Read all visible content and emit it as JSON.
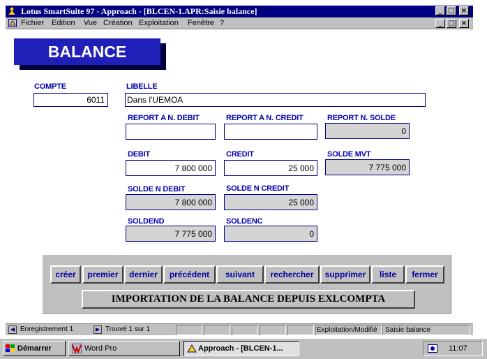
{
  "window": {
    "title_app": "Lotus SmartSuite 97",
    "title_rest": "  -  Approach - [BLCEN-1.APR:Saisie balance]",
    "controls": {
      "minimize": "_",
      "maximize": "□",
      "close": "×"
    }
  },
  "menu": {
    "items": [
      {
        "label": "Fichier"
      },
      {
        "label": "Edition"
      },
      {
        "label": "Vue"
      },
      {
        "label": "Création"
      },
      {
        "label": "Exploitation"
      },
      {
        "label": "Fenêtre"
      },
      {
        "label": "?"
      }
    ]
  },
  "form": {
    "banner": "BALANCE",
    "compte": {
      "label": "COMPTE",
      "value": "6011"
    },
    "libelle": {
      "label": "LIBELLE",
      "value": "Dans l'UEMOA"
    },
    "report_debit": {
      "label": "REPORT A N. DEBIT",
      "value": ""
    },
    "report_credit": {
      "label": "REPORT A N. CREDIT",
      "value": ""
    },
    "report_solde": {
      "label": "REPORT N. SOLDE",
      "value": "0"
    },
    "debit": {
      "label": "DEBIT",
      "value": "7 800 000"
    },
    "credit": {
      "label": "CREDIT",
      "value": "25 000"
    },
    "solde_mvt": {
      "label": "SOLDE MVT",
      "value": "7 775 000"
    },
    "solde_n_debit": {
      "label": "SOLDE N DEBIT",
      "value": "7 800 000"
    },
    "solde_n_credit": {
      "label": "SOLDE N CREDIT",
      "value": "25 000"
    },
    "soldend": {
      "label": "SOLDEND",
      "value": "7 775 000"
    },
    "soldenc": {
      "label": "SOLDENC",
      "value": "0"
    }
  },
  "buttons": {
    "creer": "créer",
    "premier": "premier",
    "dernier": "dernier",
    "precedent": "précédent",
    "suivant": "suivant",
    "rechercher": "rechercher",
    "supprimer": "supprimer",
    "liste": "liste",
    "fermer": "fermer",
    "importation": "IMPORTATION DE LA BALANCE DEPUIS EXLCOMPTA"
  },
  "status": {
    "record": "Enregistrement 1",
    "found": "Trouvé 1 sur 1",
    "mode": "Exploitation/Modifié",
    "view": "Saisie balance"
  },
  "taskbar": {
    "start": "Démarrer",
    "word_pro": "Word Pro",
    "approach": "Approach - [BLCEN-1...",
    "clock": "11:07"
  },
  "colors": {
    "title_bar": "#000080",
    "banner": "#2020b8",
    "label": "#0000b0",
    "button_text": "#0000a0",
    "chrome": "#c0c0c0"
  }
}
